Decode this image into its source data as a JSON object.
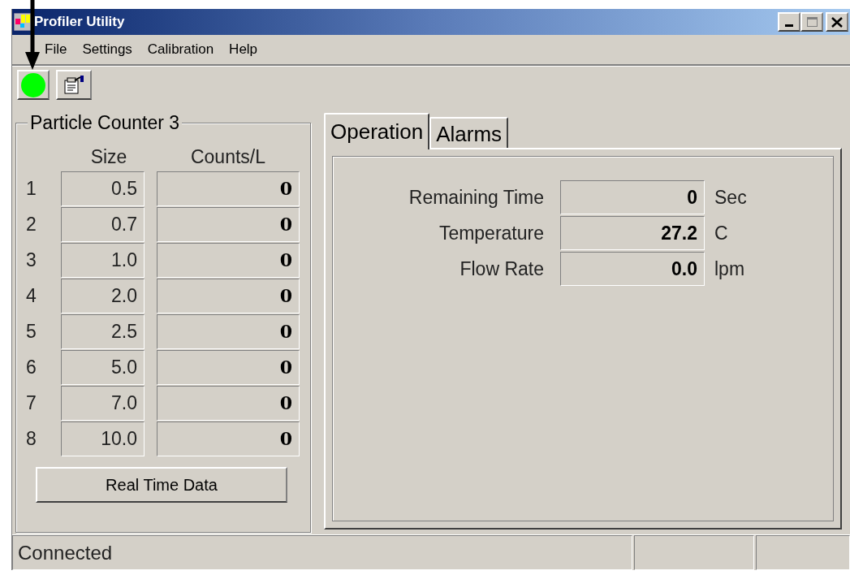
{
  "window": {
    "title": "Profiler Utility"
  },
  "menu": [
    {
      "label": "File"
    },
    {
      "label": "Settings"
    },
    {
      "label": "Calibration"
    },
    {
      "label": "Help"
    }
  ],
  "toolbar": {
    "status_light": {
      "color": "#00ff00"
    }
  },
  "particle_counter": {
    "title": "Particle Counter 3",
    "columns": [
      "Size",
      "Counts/L"
    ],
    "rows": [
      {
        "index": "1",
        "size": "0.5",
        "count": "0"
      },
      {
        "index": "2",
        "size": "0.7",
        "count": "0"
      },
      {
        "index": "3",
        "size": "1.0",
        "count": "0"
      },
      {
        "index": "4",
        "size": "2.0",
        "count": "0"
      },
      {
        "index": "5",
        "size": "2.5",
        "count": "0"
      },
      {
        "index": "6",
        "size": "5.0",
        "count": "0"
      },
      {
        "index": "7",
        "size": "7.0",
        "count": "0"
      },
      {
        "index": "8",
        "size": "10.0",
        "count": "0"
      }
    ],
    "button": "Real Time Data"
  },
  "tabs": [
    {
      "label": "Operation",
      "selected": true
    },
    {
      "label": "Alarms",
      "selected": false
    }
  ],
  "readings": [
    {
      "label": "Remaining Time",
      "value": "0",
      "unit": "Sec"
    },
    {
      "label": "Temperature",
      "value": "27.2",
      "unit": "C"
    },
    {
      "label": "Flow Rate",
      "value": "0.0",
      "unit": "lpm"
    }
  ],
  "status_bar": {
    "text": "Connected"
  }
}
